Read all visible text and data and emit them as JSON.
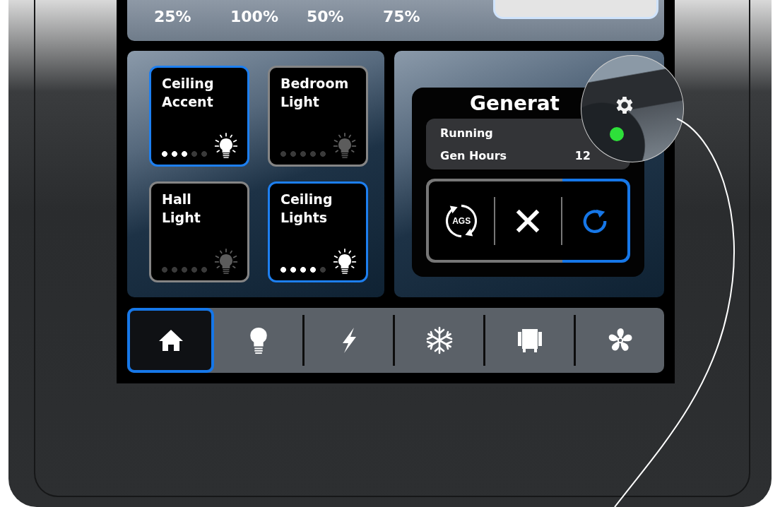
{
  "top_strip": {
    "values": [
      "25%",
      "100%",
      "50%",
      "75%"
    ]
  },
  "lights": [
    {
      "name": "Ceiling Accent",
      "on": true,
      "level": 0.6
    },
    {
      "name": "Bedroom Light",
      "on": false,
      "level": 0
    },
    {
      "name": "Hall Light",
      "on": false,
      "level": 0
    },
    {
      "name": "Ceiling Lights",
      "on": true,
      "level": 0.8
    }
  ],
  "generator": {
    "title": "Generat",
    "status": {
      "label": "Running",
      "color": "#2ee03a"
    },
    "hours": {
      "label": "Gen Hours",
      "value": "12"
    },
    "controls": [
      {
        "kind": "ags",
        "label": "AGS",
        "selected": false
      },
      {
        "kind": "stop",
        "selected": false
      },
      {
        "kind": "restart",
        "selected": true
      }
    ]
  },
  "nav": [
    {
      "kind": "home",
      "selected": true
    },
    {
      "kind": "light",
      "selected": false
    },
    {
      "kind": "power",
      "selected": false
    },
    {
      "kind": "climate",
      "selected": false
    },
    {
      "kind": "slide",
      "selected": false
    },
    {
      "kind": "fan",
      "selected": false
    }
  ]
}
